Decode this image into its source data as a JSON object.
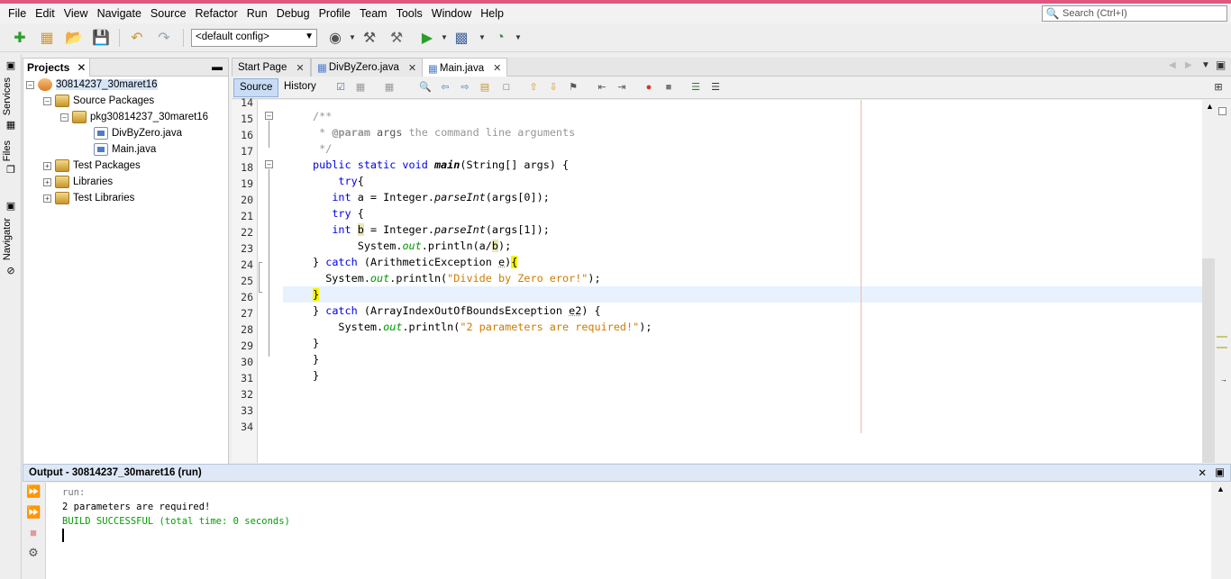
{
  "menu": [
    "File",
    "Edit",
    "View",
    "Navigate",
    "Source",
    "Refactor",
    "Run",
    "Debug",
    "Profile",
    "Team",
    "Tools",
    "Window",
    "Help"
  ],
  "search": {
    "placeholder": "Search (Ctrl+I)"
  },
  "toolbar": {
    "config_value": "<default config>"
  },
  "side_strip": {
    "services": "Services",
    "files": "Files",
    "navigator": "Navigator"
  },
  "projects": {
    "tab_label": "Projects",
    "tree": [
      {
        "label": "30814237_30maret16"
      },
      {
        "label": "Source Packages"
      },
      {
        "label": "pkg30814237_30maret16"
      },
      {
        "label": "DivByZero.java"
      },
      {
        "label": "Main.java"
      },
      {
        "label": "Test Packages"
      },
      {
        "label": "Libraries"
      },
      {
        "label": "Test Libraries"
      }
    ]
  },
  "editor": {
    "tabs": [
      {
        "label": "Start Page"
      },
      {
        "label": "DivByZero.java"
      },
      {
        "label": "Main.java"
      }
    ],
    "source_label": "Source",
    "history_label": "History",
    "line_numbers": [
      "14",
      "15",
      "16",
      "17",
      "18",
      "19",
      "20",
      "21",
      "22",
      "23",
      "24",
      "25",
      "26",
      "27",
      "28",
      "29",
      "30",
      "31",
      "32",
      "33",
      "34"
    ]
  },
  "output": {
    "title": "Output - 30814237_30maret16 (run)",
    "lines": [
      "run:",
      "2 parameters are required!",
      "BUILD SUCCESSFUL (total time: 0 seconds)"
    ]
  },
  "colors": {
    "keyword": "#0000e6",
    "comment": "#969696",
    "string": "#ce7b00",
    "build_success": "#00a000",
    "accent_bar": "#e0567f"
  }
}
